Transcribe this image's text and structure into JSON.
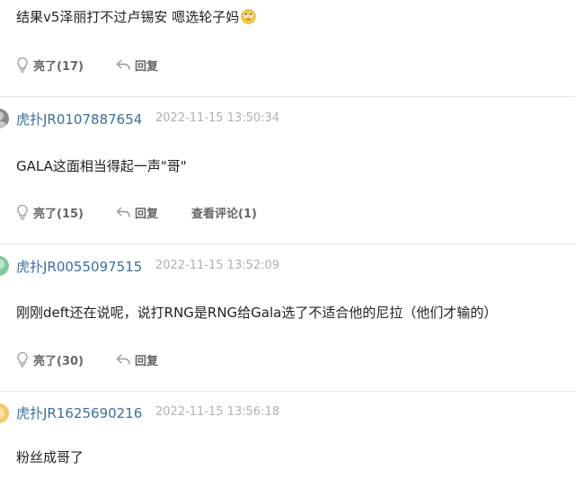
{
  "comments": [
    {
      "user": "",
      "time": "",
      "text": "结果v5泽丽打不过卢锡安  嗯选轮子妈",
      "emoji_icon": "rolling-eyes-emoji-icon",
      "like_label": "亮了(17)",
      "reply_label": "回复",
      "view_replies_label": ""
    },
    {
      "user": "虎扑JR0107887654",
      "time": "2022-11-15 13:50:34",
      "text": "GALA这面相当得起一声\"哥\"",
      "like_label": "亮了(15)",
      "reply_label": "回复",
      "view_replies_label": "查看评论(1)"
    },
    {
      "user": "虎扑JR0055097515",
      "time": "2022-11-15 13:52:09",
      "text": "刚刚deft还在说呢，说打RNG是RNG给Gala选了不适合他的尼拉（他们才输的）",
      "like_label": "亮了(30)",
      "reply_label": "回复",
      "view_replies_label": ""
    },
    {
      "user": "虎扑JR1625690216",
      "time": "2022-11-15 13:56:18",
      "text": "粉丝成哥了",
      "like_label": "",
      "reply_label": "",
      "view_replies_label": ""
    }
  ],
  "icons": {
    "like": "lightbulb-icon",
    "reply": "reply-arrow-icon",
    "avatar": "avatar"
  },
  "colors": {
    "username": "#3b6f9e",
    "timestamp": "#b0b0b0",
    "action_text": "#666666",
    "separator": "#e6e6e6",
    "avatar_1": "#8a8a8a",
    "avatar_2": "#7fc8a0",
    "avatar_3": "#f0c869"
  }
}
